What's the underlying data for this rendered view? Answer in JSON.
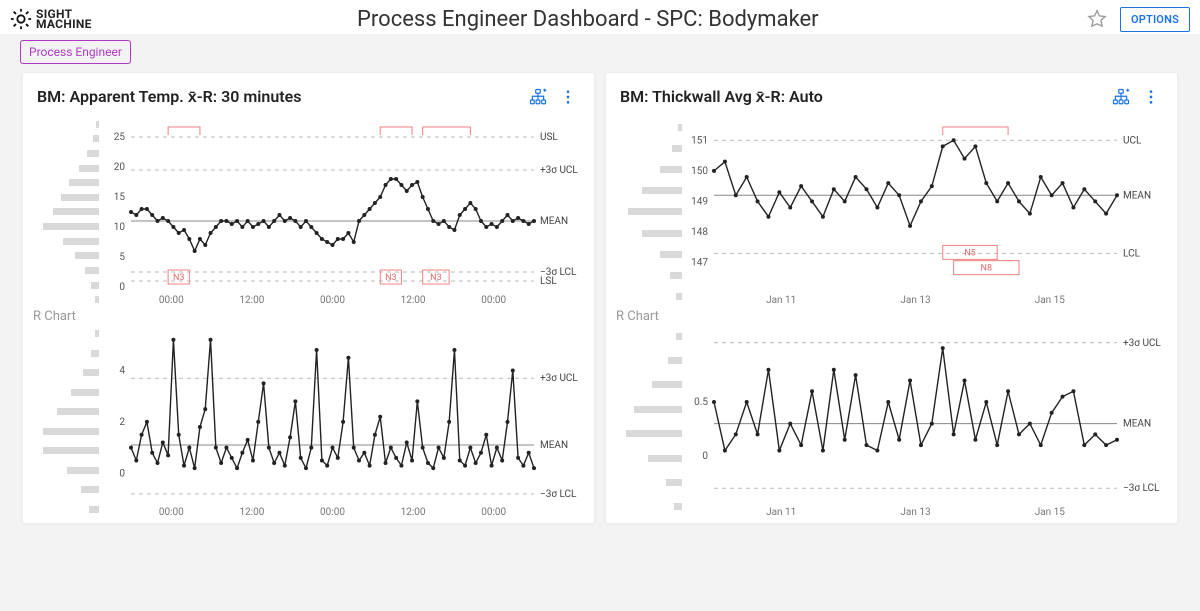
{
  "header": {
    "brand_top": "SIGHT",
    "brand_bottom": "MACHINE",
    "title": "Process Engineer Dashboard - SPC: Bodymaker",
    "options_label": "OPTIONS"
  },
  "tag": {
    "label": "Process Engineer"
  },
  "panels": {
    "left": {
      "title": "BM: Apparent Temp. x̄-R: 30 minutes",
      "rchart_label": "R Chart"
    },
    "right": {
      "title": "BM: Thickwall Avg x̄-R: Auto",
      "rchart_label": "R Chart"
    }
  },
  "chart_data": [
    {
      "id": "left-xbar",
      "type": "line",
      "title": "BM: Apparent Temp. x̄-R (x̄ chart)",
      "ylim": [
        0,
        27
      ],
      "yticks": [
        0,
        5,
        10,
        15,
        20,
        25
      ],
      "x_ticks": [
        "00:00",
        "12:00",
        "00:00",
        "12:00",
        "00:00"
      ],
      "reference_lines": {
        "USL": 25,
        "ucl_3sigma": 19.5,
        "MEAN": 11,
        "lcl_3sigma": 2.5,
        "LSL": 1
      },
      "ref_labels": [
        "USL",
        "+3σ UCL",
        "MEAN",
        "−3σ LCL",
        "LSL"
      ],
      "alarms": [
        {
          "label": "N3",
          "start": 7,
          "end": 11,
          "y": 1.5
        },
        {
          "label": "N3",
          "start": 47,
          "end": 51,
          "y": 1.5
        },
        {
          "label": "N3",
          "start": 55,
          "end": 60,
          "y": 1.5
        }
      ],
      "alarm_brackets_top": [
        {
          "start": 7,
          "end": 13
        },
        {
          "start": 47,
          "end": 53
        },
        {
          "start": 55,
          "end": 64
        }
      ],
      "series": [
        {
          "name": "xbar",
          "values": [
            12.5,
            12,
            13,
            13,
            12,
            11,
            11.5,
            11,
            10,
            9,
            9.5,
            8,
            6,
            8,
            7,
            9,
            10,
            11,
            11,
            10.5,
            11,
            10,
            11,
            10,
            10.5,
            11,
            10,
            11,
            12,
            11,
            11.5,
            11,
            10,
            11,
            10,
            9,
            8,
            7.5,
            7,
            8,
            8,
            9,
            7.5,
            11,
            12,
            13,
            14,
            15,
            17,
            18,
            18,
            17,
            16,
            17,
            17.5,
            15,
            13,
            11,
            10.5,
            11,
            10,
            9.5,
            12,
            13,
            14,
            13,
            11,
            10,
            10.5,
            10,
            11,
            12,
            11,
            11.5,
            11,
            10.5,
            11
          ]
        }
      ],
      "histogram": [
        3,
        6,
        12,
        20,
        30,
        38,
        46,
        56,
        36,
        24,
        14,
        8,
        4
      ]
    },
    {
      "id": "left-range",
      "type": "line",
      "title": "BM: Apparent Temp. x̄-R (R chart)",
      "ylim": [
        -1,
        5.5
      ],
      "yticks": [
        0,
        2,
        4
      ],
      "x_ticks": [
        "00:00",
        "12:00",
        "00:00",
        "12:00",
        "00:00"
      ],
      "reference_lines": {
        "ucl_3sigma": 3.7,
        "MEAN": 1.1,
        "lcl_3sigma": -0.8
      },
      "ref_labels": [
        "+3σ UCL",
        "MEAN",
        "−3σ LCL"
      ],
      "series": [
        {
          "name": "range",
          "values": [
            1,
            0.5,
            1.5,
            2,
            0.8,
            0.4,
            1.2,
            0.7,
            5.2,
            1.5,
            0.3,
            1,
            0.2,
            1.8,
            2.5,
            5.2,
            1,
            0.4,
            1,
            0.6,
            0.2,
            0.8,
            1.3,
            0.5,
            2,
            3.5,
            1,
            0.4,
            0.8,
            0.3,
            1.4,
            2.8,
            0.6,
            0.2,
            1,
            4.8,
            0.5,
            0.3,
            1,
            0.6,
            2,
            4.5,
            1,
            0.5,
            0.8,
            0.3,
            1.5,
            2.2,
            0.4,
            1,
            0.6,
            0.3,
            1.2,
            0.5,
            2.8,
            1,
            0.4,
            0.2,
            1,
            0.6,
            2,
            4.8,
            0.5,
            0.3,
            1,
            0.4,
            0.8,
            1.5,
            0.3,
            1,
            0.5,
            2,
            4,
            0.6,
            0.3,
            0.8,
            0.2
          ]
        }
      ],
      "histogram": [
        4,
        8,
        16,
        28,
        42,
        56,
        56,
        32,
        18,
        10
      ]
    },
    {
      "id": "right-xbar",
      "type": "line",
      "title": "BM: Thickwall Avg x̄-R (x̄ chart)",
      "ylim": [
        146.2,
        151.5
      ],
      "yticks": [
        147,
        148,
        149,
        150,
        151
      ],
      "x_ticks": [
        "Jan 11",
        "Jan 13",
        "Jan 15"
      ],
      "reference_lines": {
        "UCL": 151,
        "MEAN": 149.2,
        "LCL": 147.3
      },
      "ref_labels": [
        "UCL",
        "MEAN",
        "LCL"
      ],
      "alarms": [
        {
          "label": "N5",
          "start": 21,
          "end": 26,
          "y": 147.3
        },
        {
          "label": "N8",
          "start": 22,
          "end": 28,
          "y": 146.8
        }
      ],
      "alarm_brackets_top": [
        {
          "start": 21,
          "end": 27
        }
      ],
      "series": [
        {
          "name": "xbar",
          "values": [
            150,
            150.3,
            149.2,
            149.8,
            149,
            148.5,
            149.3,
            148.8,
            149.5,
            149,
            148.5,
            149.4,
            149,
            149.8,
            149.4,
            148.8,
            149.6,
            149.2,
            148.2,
            149,
            149.5,
            150.8,
            151,
            150.4,
            150.8,
            149.6,
            149,
            149.6,
            149,
            148.6,
            149.8,
            149.2,
            149.6,
            148.8,
            149.4,
            149,
            148.6,
            149.2
          ]
        }
      ],
      "histogram": [
        4,
        10,
        22,
        40,
        54,
        40,
        22,
        12,
        6
      ]
    },
    {
      "id": "right-range",
      "type": "line",
      "title": "BM: Thickwall Avg x̄-R (R chart)",
      "ylim": [
        -0.4,
        1.15
      ],
      "yticks": [
        0,
        0.5
      ],
      "x_ticks": [
        "Jan 11",
        "Jan 13",
        "Jan 15"
      ],
      "reference_lines": {
        "ucl_3sigma": 1.05,
        "MEAN": 0.3,
        "lcl_3sigma": -0.3
      },
      "ref_labels": [
        "+3σ UCL",
        "MEAN",
        "−3σ LCL"
      ],
      "series": [
        {
          "name": "range",
          "values": [
            0.5,
            0.05,
            0.2,
            0.5,
            0.2,
            0.8,
            0.05,
            0.3,
            0.1,
            0.6,
            0.05,
            0.8,
            0.15,
            0.75,
            0.1,
            0.05,
            0.5,
            0.15,
            0.7,
            0.1,
            0.3,
            1.0,
            0.2,
            0.7,
            0.15,
            0.5,
            0.1,
            0.6,
            0.2,
            0.3,
            0.1,
            0.4,
            0.55,
            0.6,
            0.1,
            0.2,
            0.1,
            0.15
          ]
        }
      ],
      "histogram": [
        6,
        14,
        30,
        48,
        56,
        34,
        16,
        8
      ]
    }
  ]
}
